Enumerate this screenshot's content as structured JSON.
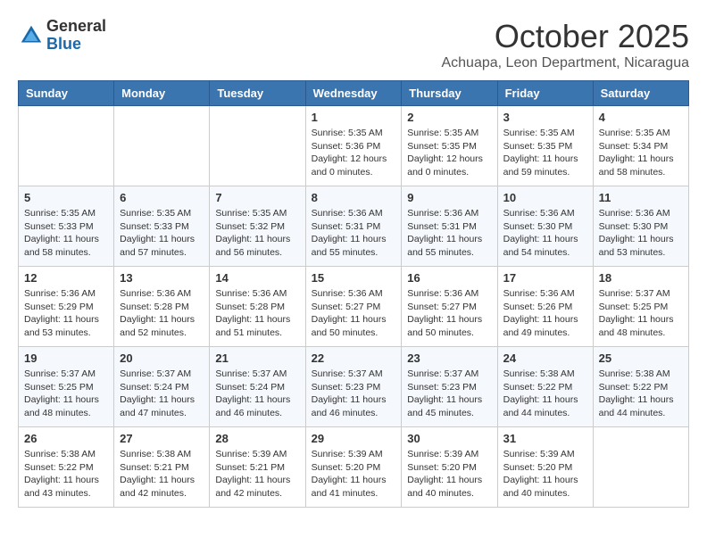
{
  "logo": {
    "general": "General",
    "blue": "Blue"
  },
  "header": {
    "month": "October 2025",
    "location": "Achuapa, Leon Department, Nicaragua"
  },
  "weekdays": [
    "Sunday",
    "Monday",
    "Tuesday",
    "Wednesday",
    "Thursday",
    "Friday",
    "Saturday"
  ],
  "weeks": [
    [
      {
        "day": "",
        "info": ""
      },
      {
        "day": "",
        "info": ""
      },
      {
        "day": "",
        "info": ""
      },
      {
        "day": "1",
        "info": "Sunrise: 5:35 AM\nSunset: 5:36 PM\nDaylight: 12 hours\nand 0 minutes."
      },
      {
        "day": "2",
        "info": "Sunrise: 5:35 AM\nSunset: 5:35 PM\nDaylight: 12 hours\nand 0 minutes."
      },
      {
        "day": "3",
        "info": "Sunrise: 5:35 AM\nSunset: 5:35 PM\nDaylight: 11 hours\nand 59 minutes."
      },
      {
        "day": "4",
        "info": "Sunrise: 5:35 AM\nSunset: 5:34 PM\nDaylight: 11 hours\nand 58 minutes."
      }
    ],
    [
      {
        "day": "5",
        "info": "Sunrise: 5:35 AM\nSunset: 5:33 PM\nDaylight: 11 hours\nand 58 minutes."
      },
      {
        "day": "6",
        "info": "Sunrise: 5:35 AM\nSunset: 5:33 PM\nDaylight: 11 hours\nand 57 minutes."
      },
      {
        "day": "7",
        "info": "Sunrise: 5:35 AM\nSunset: 5:32 PM\nDaylight: 11 hours\nand 56 minutes."
      },
      {
        "day": "8",
        "info": "Sunrise: 5:36 AM\nSunset: 5:31 PM\nDaylight: 11 hours\nand 55 minutes."
      },
      {
        "day": "9",
        "info": "Sunrise: 5:36 AM\nSunset: 5:31 PM\nDaylight: 11 hours\nand 55 minutes."
      },
      {
        "day": "10",
        "info": "Sunrise: 5:36 AM\nSunset: 5:30 PM\nDaylight: 11 hours\nand 54 minutes."
      },
      {
        "day": "11",
        "info": "Sunrise: 5:36 AM\nSunset: 5:30 PM\nDaylight: 11 hours\nand 53 minutes."
      }
    ],
    [
      {
        "day": "12",
        "info": "Sunrise: 5:36 AM\nSunset: 5:29 PM\nDaylight: 11 hours\nand 53 minutes."
      },
      {
        "day": "13",
        "info": "Sunrise: 5:36 AM\nSunset: 5:28 PM\nDaylight: 11 hours\nand 52 minutes."
      },
      {
        "day": "14",
        "info": "Sunrise: 5:36 AM\nSunset: 5:28 PM\nDaylight: 11 hours\nand 51 minutes."
      },
      {
        "day": "15",
        "info": "Sunrise: 5:36 AM\nSunset: 5:27 PM\nDaylight: 11 hours\nand 50 minutes."
      },
      {
        "day": "16",
        "info": "Sunrise: 5:36 AM\nSunset: 5:27 PM\nDaylight: 11 hours\nand 50 minutes."
      },
      {
        "day": "17",
        "info": "Sunrise: 5:36 AM\nSunset: 5:26 PM\nDaylight: 11 hours\nand 49 minutes."
      },
      {
        "day": "18",
        "info": "Sunrise: 5:37 AM\nSunset: 5:25 PM\nDaylight: 11 hours\nand 48 minutes."
      }
    ],
    [
      {
        "day": "19",
        "info": "Sunrise: 5:37 AM\nSunset: 5:25 PM\nDaylight: 11 hours\nand 48 minutes."
      },
      {
        "day": "20",
        "info": "Sunrise: 5:37 AM\nSunset: 5:24 PM\nDaylight: 11 hours\nand 47 minutes."
      },
      {
        "day": "21",
        "info": "Sunrise: 5:37 AM\nSunset: 5:24 PM\nDaylight: 11 hours\nand 46 minutes."
      },
      {
        "day": "22",
        "info": "Sunrise: 5:37 AM\nSunset: 5:23 PM\nDaylight: 11 hours\nand 46 minutes."
      },
      {
        "day": "23",
        "info": "Sunrise: 5:37 AM\nSunset: 5:23 PM\nDaylight: 11 hours\nand 45 minutes."
      },
      {
        "day": "24",
        "info": "Sunrise: 5:38 AM\nSunset: 5:22 PM\nDaylight: 11 hours\nand 44 minutes."
      },
      {
        "day": "25",
        "info": "Sunrise: 5:38 AM\nSunset: 5:22 PM\nDaylight: 11 hours\nand 44 minutes."
      }
    ],
    [
      {
        "day": "26",
        "info": "Sunrise: 5:38 AM\nSunset: 5:22 PM\nDaylight: 11 hours\nand 43 minutes."
      },
      {
        "day": "27",
        "info": "Sunrise: 5:38 AM\nSunset: 5:21 PM\nDaylight: 11 hours\nand 42 minutes."
      },
      {
        "day": "28",
        "info": "Sunrise: 5:39 AM\nSunset: 5:21 PM\nDaylight: 11 hours\nand 42 minutes."
      },
      {
        "day": "29",
        "info": "Sunrise: 5:39 AM\nSunset: 5:20 PM\nDaylight: 11 hours\nand 41 minutes."
      },
      {
        "day": "30",
        "info": "Sunrise: 5:39 AM\nSunset: 5:20 PM\nDaylight: 11 hours\nand 40 minutes."
      },
      {
        "day": "31",
        "info": "Sunrise: 5:39 AM\nSunset: 5:20 PM\nDaylight: 11 hours\nand 40 minutes."
      },
      {
        "day": "",
        "info": ""
      }
    ]
  ]
}
